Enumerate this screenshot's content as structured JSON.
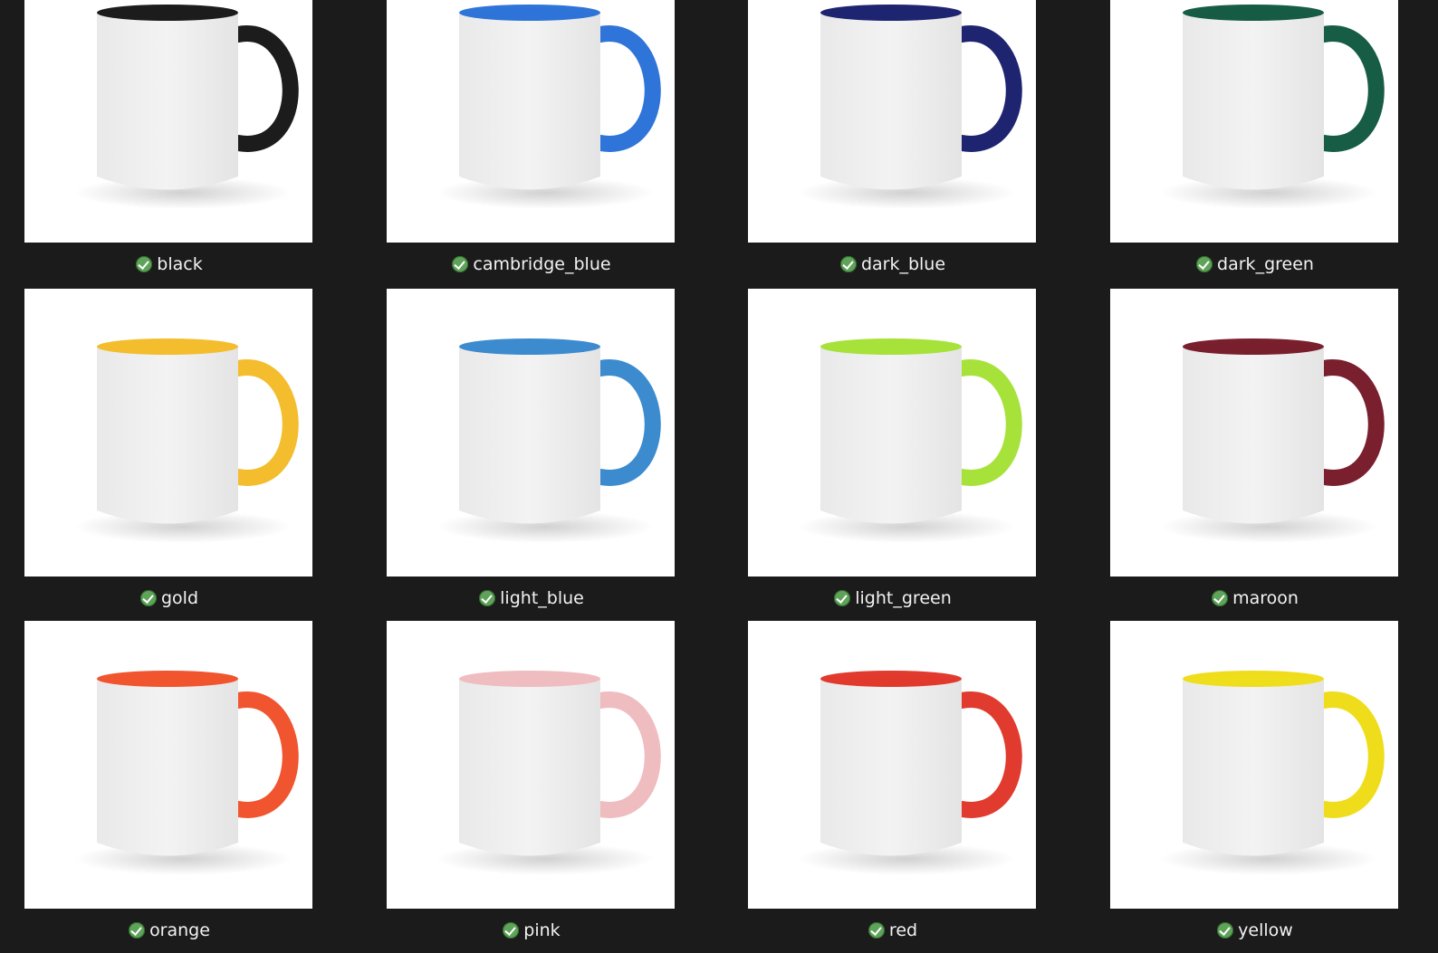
{
  "gallery": {
    "status_icon": "green-checkmark-icon",
    "items": [
      {
        "label": "black",
        "color": "#1c1c1c"
      },
      {
        "label": "cambridge_blue",
        "color": "#2f74d8"
      },
      {
        "label": "dark_blue",
        "color": "#1e2470"
      },
      {
        "label": "dark_green",
        "color": "#175c45"
      },
      {
        "label": "gold",
        "color": "#f3bd2e"
      },
      {
        "label": "light_blue",
        "color": "#3c8bcf"
      },
      {
        "label": "light_green",
        "color": "#a6e23a"
      },
      {
        "label": "maroon",
        "color": "#7a1f2e"
      },
      {
        "label": "orange",
        "color": "#f0552f"
      },
      {
        "label": "pink",
        "color": "#efbcc0"
      },
      {
        "label": "red",
        "color": "#e13a2e"
      },
      {
        "label": "yellow",
        "color": "#efdd1c"
      }
    ]
  }
}
